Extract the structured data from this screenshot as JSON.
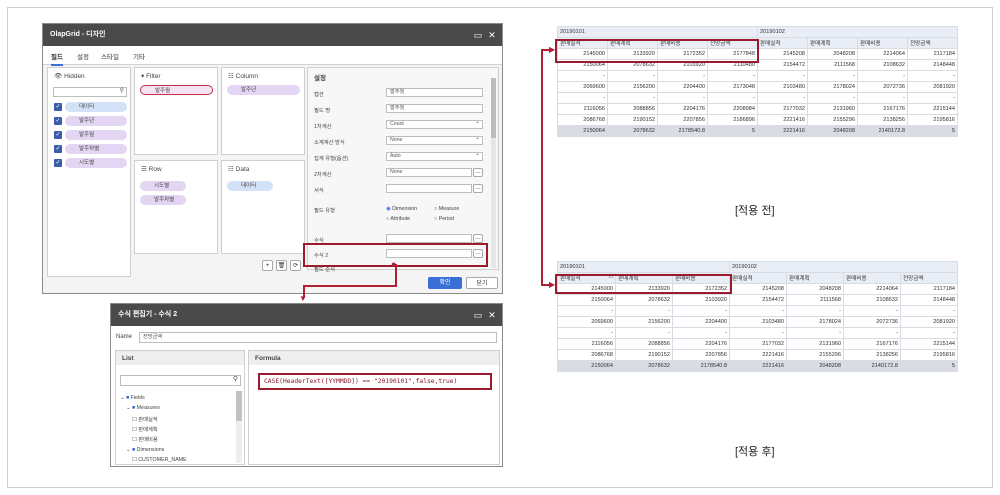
{
  "designer": {
    "title": "OlapGrid - 디자인",
    "tabs": [
      "필드",
      "설정",
      "스타일",
      "기타"
    ],
    "hidden": {
      "title": "Hidden",
      "items": [
        "데이터",
        "발주년",
        "발주월",
        "발주차별",
        "시도별"
      ]
    },
    "filter": {
      "title": "Filter",
      "items": [
        "발주월"
      ]
    },
    "column": {
      "title": "Column",
      "items": [
        "발주년"
      ]
    },
    "row": {
      "title": "Row",
      "items": [
        "시도별",
        "발주차별"
      ]
    },
    "data": {
      "title": "Data",
      "items": [
        "데이터"
      ]
    },
    "settings": {
      "title": "설정",
      "rows": [
        {
          "label": "캡션",
          "value": "발주월",
          "type": "text"
        },
        {
          "label": "필드 명",
          "value": "발주월",
          "type": "text"
        },
        {
          "label": "1차계산",
          "value": "Count",
          "type": "dropdown"
        },
        {
          "label": "소계계산 방식",
          "value": "None",
          "type": "dropdown"
        },
        {
          "label": "집계 유형(옵션)",
          "value": "Auto",
          "type": "dropdown"
        },
        {
          "label": "2차계산",
          "value": "None",
          "type": "button"
        },
        {
          "label": "서식",
          "value": "",
          "type": "button"
        }
      ],
      "field_type_label": "필드 유형",
      "field_type_options": [
        "Dimension",
        "Measure",
        "Attribute",
        "Period"
      ],
      "formula_label": "수식",
      "formula2_label": "수식 2",
      "formula3_label": "필드 순서"
    },
    "ok_label": "확인",
    "close_label": "닫기"
  },
  "editor": {
    "title": "수식 편집기 - 수식 2",
    "name_label": "Name",
    "name_value": "전망금액",
    "list_label": "List",
    "formula_label": "Formula",
    "formula_text": "CASE(HeaderText([YYMMDD]) == \"20190101\",false,true)",
    "tree": {
      "fields": "Fields",
      "measures": "Measures",
      "measure_items": [
        "판매실적",
        "판매계획",
        "판매비용"
      ],
      "dimensions": "Dimensions",
      "dimension_items": [
        "CUSTOMER_NAME"
      ]
    }
  },
  "grid_before": {
    "caption": "[적용 전]",
    "groups": [
      "20190101",
      "20190102"
    ],
    "headers": [
      "판매실적",
      "판매계획",
      "판매비용",
      "전망금액",
      "판매실적",
      "판매계획",
      "판매비용",
      "전망금액"
    ],
    "rows": [
      [
        "2145000",
        "2133920",
        "2172352",
        "2177848",
        "2145208",
        "2048208",
        "2214064",
        "2117184"
      ],
      [
        "2150064",
        "2078632",
        "2103920",
        "2110480",
        "2154472",
        "2111568",
        "2108632",
        "2148448"
      ],
      [
        "-",
        "-",
        "-",
        "-",
        "-",
        "-",
        "-",
        "-"
      ],
      [
        "2069600",
        "2156200",
        "2204400",
        "2173048",
        "2103480",
        "2178024",
        "2072736",
        "2081920"
      ],
      [
        "-",
        "-",
        "-",
        "-",
        "-",
        "-",
        "-",
        "-"
      ],
      [
        "2116056",
        "2088856",
        "2204176",
        "2208984",
        "2177032",
        "2131960",
        "2167176",
        "2215144"
      ],
      [
        "2086768",
        "2190152",
        "2207856",
        "2186896",
        "2221416",
        "2155296",
        "2138256",
        "2195816"
      ],
      [
        "2150064",
        "2078632",
        "2178540.8",
        "5",
        "2221416",
        "2048208",
        "2140172.8",
        "5"
      ]
    ]
  },
  "grid_after": {
    "caption": "[적용 후]",
    "groups": [
      "20190101",
      "20190102"
    ],
    "headers": [
      "판매실적",
      "판매계획",
      "판매비용",
      "판매실적",
      "판매계획",
      "판매비용",
      "전망금액"
    ],
    "sort_icon": "△",
    "rows": [
      [
        "2145000",
        "2133920",
        "2172352",
        "2145208",
        "2048208",
        "2214064",
        "2117184"
      ],
      [
        "2150064",
        "2078632",
        "2103920",
        "2154472",
        "2111568",
        "2108632",
        "2148448"
      ],
      [
        "-",
        "-",
        "-",
        "-",
        "-",
        "-",
        "-"
      ],
      [
        "2069600",
        "2156200",
        "2204400",
        "2103480",
        "2178024",
        "2072736",
        "2081920"
      ],
      [
        "-",
        "-",
        "-",
        "-",
        "-",
        "-",
        "-"
      ],
      [
        "2116056",
        "2088856",
        "2204176",
        "2177032",
        "2131960",
        "2167176",
        "2215144"
      ],
      [
        "2086768",
        "2190152",
        "2207856",
        "2221416",
        "2155296",
        "2138256",
        "2195816"
      ],
      [
        "2150064",
        "2078632",
        "2178540.8",
        "2221416",
        "2048208",
        "2140172.8",
        "5"
      ]
    ]
  },
  "colors": {
    "accent": "#3b6fd6",
    "highlight": "#9a1b2e",
    "pill": "#e3d6f3",
    "header": "#e9edf5"
  }
}
